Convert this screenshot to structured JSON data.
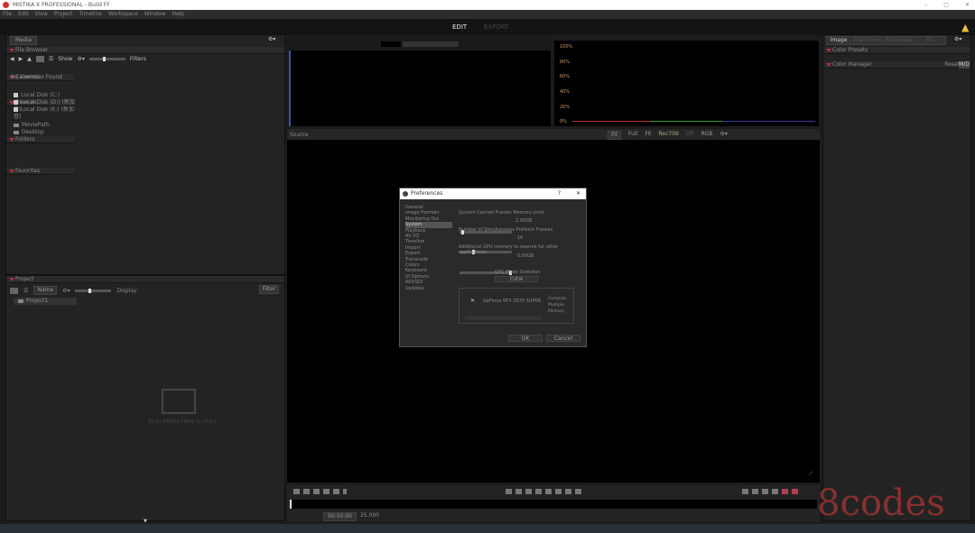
{
  "window": {
    "title": "MISTIKA X PROFESSIONAL - Build FF",
    "controls": [
      "–",
      "▢",
      "✕"
    ]
  },
  "menu": [
    "File",
    "Edit",
    "View",
    "Project",
    "Timeline",
    "Workspace",
    "Window",
    "Help"
  ],
  "modes": {
    "edit": "EDIT",
    "export": "EXPORT"
  },
  "left": {
    "tab": "Media",
    "browser": "File Browser",
    "sort": "Show",
    "size_label": "Filters",
    "cameras": {
      "title": "Cameras",
      "empty": "No Cameras Found"
    },
    "devices": {
      "title": "Devices",
      "items": [
        "Local Disk (C:)",
        "Local Disk (D:) (新加卷)",
        "Local Disk (E:) (新加卷)"
      ]
    },
    "folders": {
      "title": "Folders",
      "items": [
        "MoviePath",
        "Desktop"
      ]
    },
    "favorites": {
      "title": "Favorites"
    }
  },
  "project": {
    "title": "Project",
    "sort": "Name",
    "size_label": "Display",
    "filter": "Filter",
    "item": "Project1",
    "empty": "Drag Media Here to Start"
  },
  "scopes": {
    "labels": [
      "100%",
      "80%",
      "60%",
      "40%",
      "20%",
      "0%"
    ],
    "colors": {
      "red": "#b03030",
      "green": "#3a9a3a",
      "blue": "#3a3aa0"
    }
  },
  "viewer": {
    "title": "Source",
    "controls": [
      "Fit",
      "Full",
      "Fit",
      "Rec709",
      "Off",
      "RGB"
    ],
    "timecode": "00:00:00",
    "fps": "25.000"
  },
  "right": {
    "tabs": [
      "Image",
      "Transform",
      "Metadata",
      "Etc"
    ],
    "rows": [
      {
        "label": "Color Presets"
      },
      {
        "label": "Color Manager",
        "value": "Reset",
        "btn": "M/D"
      }
    ]
  },
  "prefs": {
    "title": "Preferences",
    "help": "?",
    "close": "✕",
    "categories": [
      "General",
      "Image Formats",
      "Monitoring Out",
      "System",
      "Playback",
      "AV I/O",
      "Timeline",
      "Import",
      "Export",
      "Transcode",
      "Colors",
      "Keyboard",
      "UI Options",
      "NDI/SDI",
      "Updates"
    ],
    "selected": "System",
    "cache_label": "System Cached Frames Memory Limit",
    "cache_value": "2.00GB",
    "cache_level": 0.05,
    "prefetch_label": "Number of Simultaneous Prefetch Frames",
    "prefetch_value": "16",
    "prefetch_level": 0.25,
    "gpu_reserve_label": "Additional GPU memory to reserve for other applications",
    "gpu_reserve_value": "0.00GB",
    "gpu_reserve_level": 0.95,
    "gpu_mode_label": "GPU Mode Selection",
    "gpu_mode": "CUDA",
    "gpu_name": "GeForce RTX 2070 SUPER",
    "gpu_cols": [
      "Compute",
      "Multiple",
      "Memory"
    ],
    "ok": "OK",
    "cancel": "Cancel"
  },
  "watermark": "8codes"
}
